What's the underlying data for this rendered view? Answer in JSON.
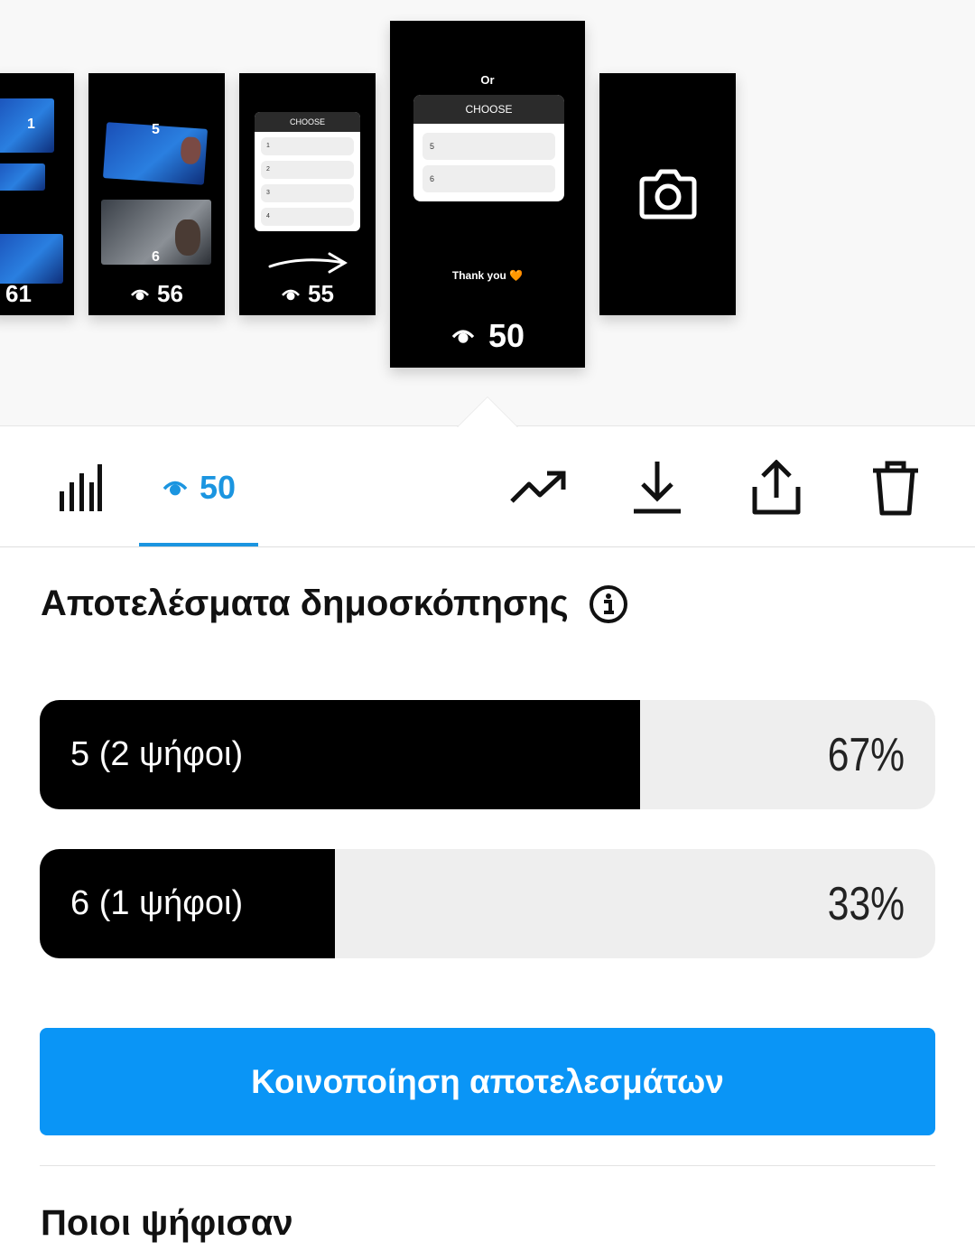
{
  "stories": [
    {
      "views": "61",
      "numbers": [
        "1"
      ]
    },
    {
      "views": "56",
      "numbers": [
        "5",
        "6"
      ]
    },
    {
      "views": "55",
      "poll": {
        "header": "CHOOSE",
        "options": [
          "1",
          "2",
          "3",
          "4"
        ]
      }
    },
    {
      "views": "50",
      "top_text": "Or",
      "poll": {
        "header": "CHOOSE",
        "options": [
          "5",
          "6"
        ]
      },
      "caption": "Thank you 🧡",
      "selected": true
    },
    {
      "icon": "camera-icon"
    }
  ],
  "toolbar": {
    "views_count": "50",
    "accent_color": "#1b95e0",
    "icons": [
      "bar-chart-icon",
      "eye-icon",
      "trending-up-icon",
      "download-icon",
      "share-icon",
      "trash-icon"
    ]
  },
  "poll_results": {
    "title": "Αποτελέσματα δημοσκόπησης",
    "results": [
      {
        "label": "5 (2 ψήφοι)",
        "percent_text": "67%",
        "fraction": 0.67
      },
      {
        "label": "6 (1 ψήφοι)",
        "percent_text": "33%",
        "fraction": 0.33
      }
    ],
    "share_button": "Κοινοποίηση αποτελεσμάτων",
    "share_color": "#0a95f6"
  },
  "voters": {
    "title": "Ποιοι ψήφισαν"
  }
}
